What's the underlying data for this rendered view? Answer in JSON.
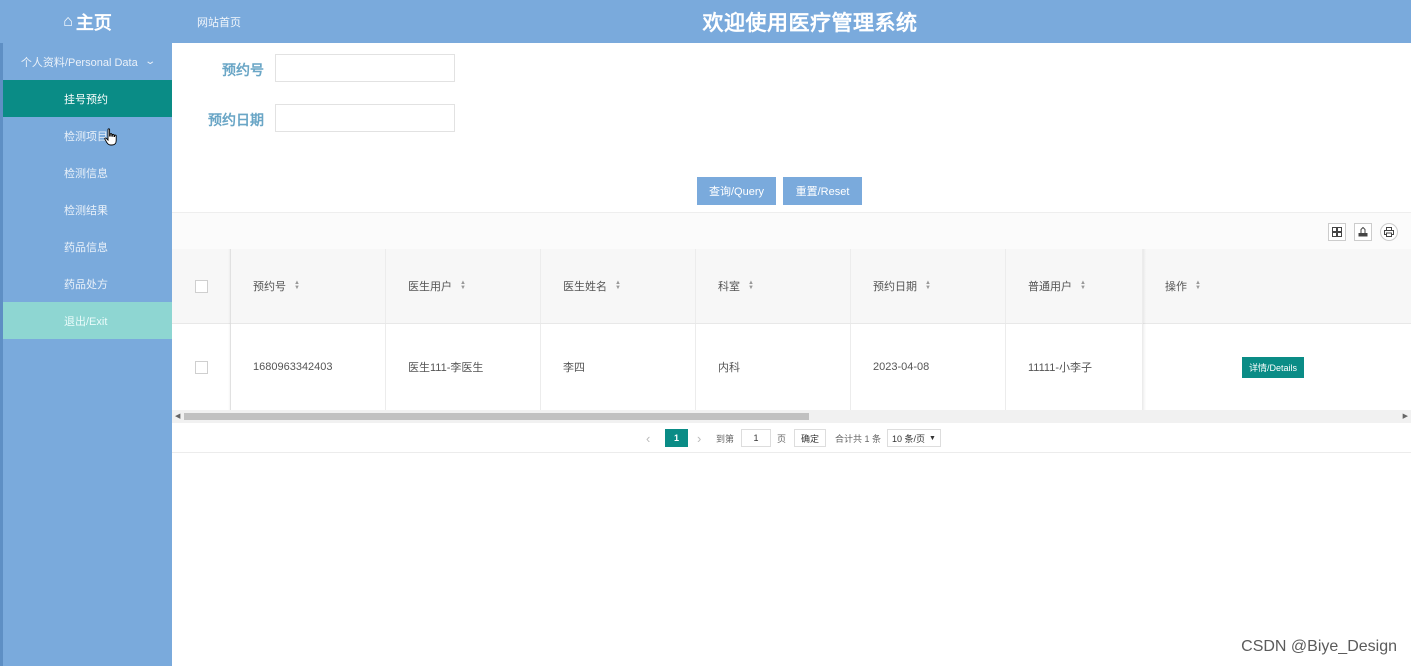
{
  "header": {
    "brand": "主页",
    "site_home": "网站首页",
    "system_title": "欢迎使用医疗管理系统"
  },
  "sidebar": {
    "group_label": "个人资料/Personal Data",
    "items": [
      {
        "label": "挂号预约"
      },
      {
        "label": "检测项目"
      },
      {
        "label": "检测信息"
      },
      {
        "label": "检测结果"
      },
      {
        "label": "药品信息"
      },
      {
        "label": "药品处方"
      },
      {
        "label": "退出/Exit"
      }
    ]
  },
  "search": {
    "fields": [
      {
        "label": "预约号",
        "value": ""
      },
      {
        "label": "预约日期",
        "value": ""
      }
    ],
    "query_label": "查询/Query",
    "reset_label": "重置/Reset"
  },
  "table": {
    "columns": [
      "预约号",
      "医生用户",
      "医生姓名",
      "科室",
      "预约日期",
      "普通用户",
      "操作"
    ],
    "rows": [
      {
        "cells": [
          "1680963342403",
          "医生111-李医生",
          "李四",
          "内科",
          "2023-04-08",
          "11111-小李子"
        ],
        "action": "详情/Details"
      }
    ]
  },
  "pagination": {
    "current_page": "1",
    "goto_prefix": "到第",
    "goto_value": "1",
    "goto_suffix": "页",
    "confirm": "确定",
    "total": "合计共 1 条",
    "page_size": "10 条/页"
  },
  "watermark": "CSDN @Biye_Design",
  "colors": {
    "header_bg": "#7aaadc",
    "accent": "#0a8c86",
    "exit_bg": "#8ed6d2",
    "label": "#6aa6c6"
  },
  "icons": [
    "home-icon",
    "chevron-down-icon",
    "columns-icon",
    "export-icon",
    "print-icon",
    "sort-icon",
    "hand-cursor-icon"
  ]
}
